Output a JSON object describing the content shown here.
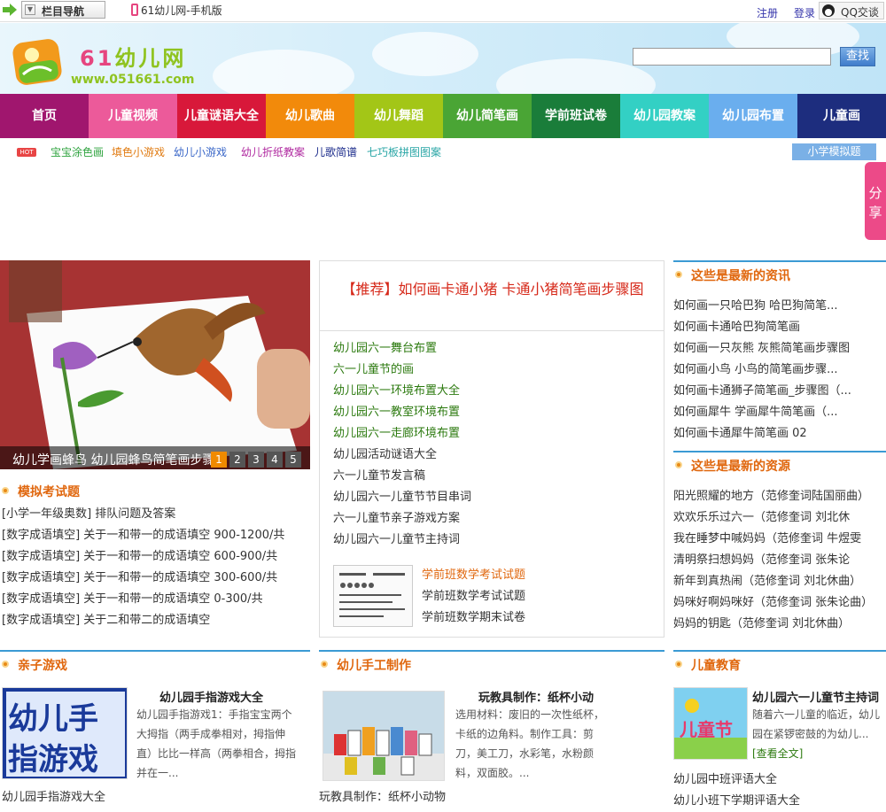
{
  "topbar": {
    "nav_label": "栏目导航",
    "mobile_label": "61幼儿网-手机版",
    "register": "注册",
    "login": "登录",
    "qq": "QQ交谈"
  },
  "header": {
    "logo_text": "61幼儿网",
    "logo_num": "61",
    "logo_cn": "幼儿网",
    "logo_url": "www.051661.com",
    "search_placeholder": "",
    "search_button": "查找"
  },
  "mainnav": [
    {
      "label": "首页",
      "color": "#a0166e"
    },
    {
      "label": "儿童视频",
      "color": "#ec5a9a"
    },
    {
      "label": "儿童谜语大全",
      "color": "#d8183a"
    },
    {
      "label": "幼儿歌曲",
      "color": "#f28a0b"
    },
    {
      "label": "幼儿舞蹈",
      "color": "#a3c617"
    },
    {
      "label": "幼儿简笔画",
      "color": "#4aa535"
    },
    {
      "label": "学前班试卷",
      "color": "#1a7d3a"
    },
    {
      "label": "幼儿园教案",
      "color": "#33d0c4"
    },
    {
      "label": "幼儿园布置",
      "color": "#6aaeee"
    },
    {
      "label": "儿童画",
      "color": "#1d2d7e"
    }
  ],
  "subnav": {
    "hot": "HOT",
    "links": [
      {
        "label": "宝宝涂色画",
        "color": "#2fa33f"
      },
      {
        "label": "填色小游戏",
        "color": "#e07a10"
      },
      {
        "label": "幼儿小游戏",
        "color": "#3a67c8"
      },
      {
        "label": "幼儿折纸教案",
        "color": "#b02aa0"
      },
      {
        "label": "儿歌简谱",
        "color": "#1a2a8a"
      },
      {
        "label": "七巧板拼图图案",
        "color": "#2aa6a6"
      }
    ],
    "right_button": "小学模拟题"
  },
  "share": "分享",
  "slideshow": {
    "caption": "幼儿学画蜂鸟 幼儿园蜂鸟简笔画步骤",
    "pages": [
      "1",
      "2",
      "3",
      "4",
      "5"
    ],
    "active_page": 1
  },
  "exam": {
    "title": "模拟考试题",
    "items": [
      "[小学一年级奥数] 排队问题及答案",
      "[数字成语填空] 关于一和带一的成语填空 900-1200/共",
      "[数字成语填空] 关于一和带一的成语填空 600-900/共",
      "[数字成语填空] 关于一和带一的成语填空 300-600/共",
      "[数字成语填空] 关于一和带一的成语填空 0-300/共",
      "[数字成语填空] 关于二和带二的成语填空"
    ]
  },
  "center": {
    "recommend": "【推荐】如何画卡通小猪 卡通小猪简笔画步骤图",
    "green_items": [
      "幼儿园六一舞台布置",
      "六一儿童节的画",
      "幼儿园六一环境布置大全",
      "幼儿园六一教室环境布置",
      "幼儿园六一走廊环境布置"
    ],
    "items": [
      "幼儿园活动谜语大全",
      "六一儿童节发言稿",
      "幼儿园六一儿童节节目串词",
      "六一儿童节亲子游戏方案",
      "幼儿园六一儿童节主持词"
    ],
    "feature_title": "学前班数学考试试题",
    "feature_items": [
      "学前班数学考试试题",
      "学前班数学期末试卷"
    ]
  },
  "news": {
    "title": "这些是最新的资讯",
    "items": [
      "如何画一只哈巴狗 哈巴狗简笔...",
      "如何画卡通哈巴狗简笔画",
      "如何画一只灰熊 灰熊简笔画步骤图",
      "如何画小鸟 小鸟的简笔画步骤...",
      "如何画卡通狮子简笔画_步骤图（...",
      "如何画犀牛 学画犀牛简笔画（...",
      "如何画卡通犀牛简笔画 02"
    ]
  },
  "resources": {
    "title": "这些是最新的资源",
    "items": [
      "阳光照耀的地方（范修奎词陆国丽曲）",
      "欢欢乐乐过六一（范修奎词 刘北休",
      "我在睡梦中喊妈妈（范修奎词 牛煜雯",
      "清明祭扫想妈妈（范修奎词 张朱论",
      "新年到真热闹（范修奎词 刘北休曲）",
      "妈咪好啊妈咪好（范修奎词 张朱论曲）",
      "妈妈的钥匙（范修奎词 刘北休曲）"
    ]
  },
  "games": {
    "title": "亲子游戏",
    "card_title": "幼儿园手指游戏大全",
    "card_desc": "幼儿园手指游戏1：手指宝宝两个大拇指（两手成拳相对，拇指伸直）比比一样高（两拳相合，拇指并在一...",
    "img_text": "幼儿手指游戏",
    "bottom": "幼儿园手指游戏大全"
  },
  "craft": {
    "title": "幼儿手工制作",
    "card_title": "玩教具制作：纸杯小动",
    "card_desc": "选用材料：废旧的一次性纸杯，卡纸的边角料。制作工具：剪刀，美工刀，水彩笔，水粉颜料，双面胶。...",
    "bottom": "玩教具制作：纸杯小动物"
  },
  "edu": {
    "title": "儿童教育",
    "card_title": "幼儿园六一儿童节主持词",
    "card_desc": "随着六一儿童的临近，幼儿园在紧锣密鼓的为幼儿...",
    "more": "[查看全文]",
    "img_text": "儿童节",
    "bottom": [
      "幼儿园中班评语大全",
      "幼儿小班下学期评语大全"
    ]
  }
}
